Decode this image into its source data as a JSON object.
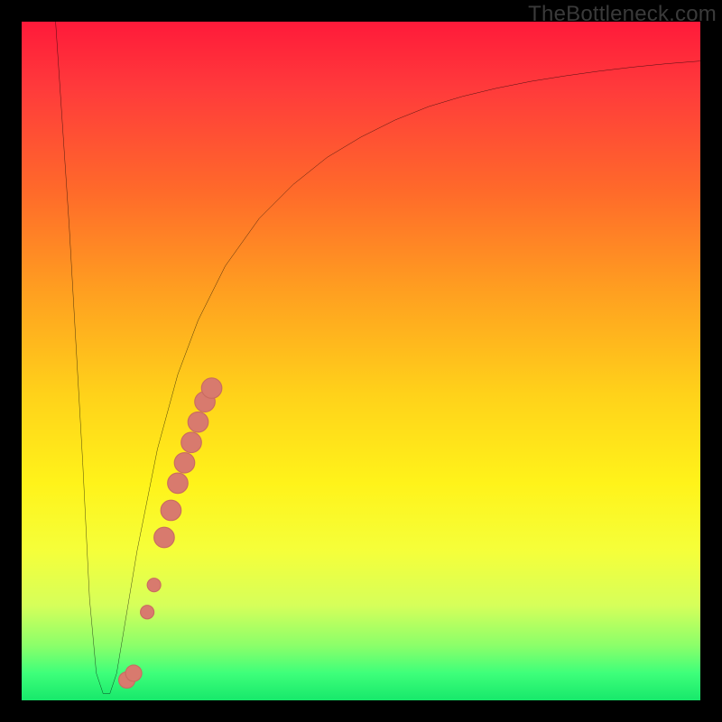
{
  "watermark": "TheBottleneck.com",
  "colors": {
    "background": "#000000",
    "curve_stroke": "#000000",
    "marker_fill": "#d87a6e",
    "marker_stroke": "#c96b60"
  },
  "chart_data": {
    "type": "line",
    "title": "",
    "xlabel": "",
    "ylabel": "",
    "xlim": [
      0,
      100
    ],
    "ylim": [
      0,
      100
    ],
    "grid": false,
    "legend": false,
    "series": [
      {
        "name": "bottleneck-curve",
        "x": [
          5,
          7,
          9,
          10,
          11,
          12,
          13,
          14,
          15,
          17,
          20,
          23,
          26,
          30,
          35,
          40,
          45,
          50,
          55,
          60,
          65,
          70,
          75,
          80,
          85,
          90,
          95,
          100
        ],
        "y": [
          100,
          70,
          35,
          15,
          4,
          1,
          1,
          4,
          10,
          22,
          37,
          48,
          56,
          64,
          71,
          76,
          80,
          83,
          85.5,
          87.5,
          89,
          90.2,
          91.2,
          92,
          92.7,
          93.3,
          93.8,
          94.2
        ]
      }
    ],
    "markers": [
      {
        "x": 15.5,
        "y": 3,
        "r": 1.2
      },
      {
        "x": 16.5,
        "y": 4,
        "r": 1.2
      },
      {
        "x": 18.5,
        "y": 13,
        "r": 1.0
      },
      {
        "x": 19.5,
        "y": 17,
        "r": 1.0
      },
      {
        "x": 21.0,
        "y": 24,
        "r": 1.5
      },
      {
        "x": 22.0,
        "y": 28,
        "r": 1.5
      },
      {
        "x": 23.0,
        "y": 32,
        "r": 1.5
      },
      {
        "x": 24.0,
        "y": 35,
        "r": 1.5
      },
      {
        "x": 25.0,
        "y": 38,
        "r": 1.5
      },
      {
        "x": 26.0,
        "y": 41,
        "r": 1.5
      },
      {
        "x": 27.0,
        "y": 44,
        "r": 1.5
      },
      {
        "x": 28.0,
        "y": 46,
        "r": 1.5
      }
    ]
  }
}
